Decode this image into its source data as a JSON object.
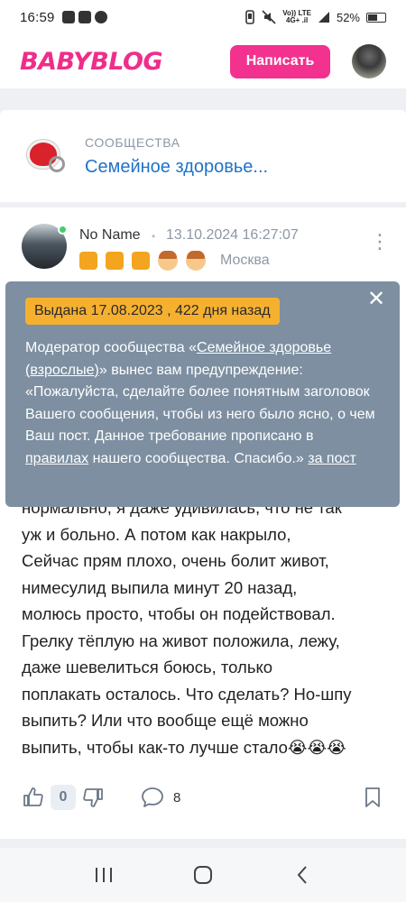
{
  "status_bar": {
    "time": "16:59",
    "battery": "52%",
    "net_top": "Vo)) LTE",
    "net_mid": "4G+ .il"
  },
  "header": {
    "logo": "BABYBLOG",
    "write_button": "Написать"
  },
  "community": {
    "section_label": "СООБЩЕСТВА",
    "name": "Семейное здоровье..."
  },
  "post": {
    "author": "No Name",
    "separator": "•",
    "datetime": "13.10.2024 16:27:07",
    "city": "Москва",
    "menu_glyph": "⋮",
    "body_lines": [
      "нормально, я даже удивилась, что не так",
      "уж и больно. А потом как накрыло,",
      "Сейчас прям плохо, очень болит живот,",
      "нимесулид выпила минут 20 назад,",
      "молюсь просто, чтобы он подействовал.",
      "Грелку тёплую на живот положила, лежу,",
      "даже шевелиться боюсь, только",
      "поплакать осталось. Что сделать? Но-шпу",
      "выпить? Или что вообще ещё можно",
      "выпить, чтобы как-то лучше стало😭😭😭"
    ],
    "rating": "0",
    "comments_count": "8"
  },
  "warning": {
    "issued": "Выдана 17.08.2023 , 422 дня назад",
    "close": "✕",
    "msg_part1": "Модератор сообщества «",
    "community_link": "Семейное здоровье (взрослые)",
    "msg_part2": "» вынес вам предупреждение: «Пожалуйста, сделайте более понятным заголовок Вашего сообщения, чтобы из него было ясно, о чем Ваш пост. Данное требование прописано в ",
    "rules_link": "правилах",
    "msg_part3": " нашего сообщества. Спасибо.» ",
    "post_link": "за пост"
  },
  "colors": {
    "brand_pink": "#f3318f",
    "link_blue": "#1f73c9",
    "tooltip_bg": "#7d8fa1",
    "badge_orange": "#f6b030"
  }
}
